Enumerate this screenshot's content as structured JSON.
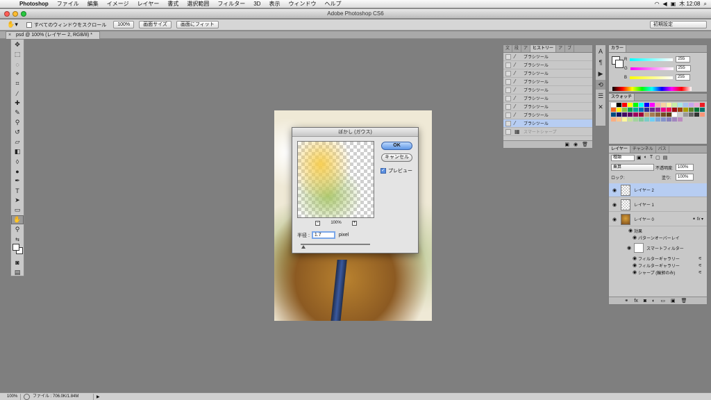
{
  "menubar": {
    "app": "Photoshop",
    "items": [
      "ファイル",
      "編集",
      "イメージ",
      "レイヤー",
      "書式",
      "選択範囲",
      "フィルター",
      "3D",
      "表示",
      "ウィンドウ",
      "ヘルプ"
    ],
    "clock": "木 12:08"
  },
  "window": {
    "title": "Adobe Photoshop CS6",
    "colors": {
      "close": "#ff5f57",
      "min": "#febc2e",
      "max": "#28c840"
    }
  },
  "options_bar": {
    "scroll_all_label": "すべてのウィンドウをスクロール",
    "zoom_100_label": "100%",
    "fit_screen_label": "画面サイズ",
    "fill_screen_label": "画面にフィット",
    "workspace": "初期設定"
  },
  "document_tab": {
    "title": "psd @ 100% (レイヤー 2, RGB/8) *"
  },
  "dialog": {
    "title": "ぼかし (ガウス)",
    "ok": "OK",
    "cancel": "キャンセル",
    "preview_label": "プレビュー",
    "zoom": "100%",
    "radius_label": "半径 :",
    "radius_value": "1.7",
    "unit": "pixel",
    "slider_fraction": 0.04
  },
  "history": {
    "tabs": [
      "文",
      "段",
      "ア",
      "ヒストリー",
      "ア",
      "ブ"
    ],
    "active_tab_index": 3,
    "items": [
      {
        "label": "ブラシツール",
        "state": "normal"
      },
      {
        "label": "ブラシツール",
        "state": "normal"
      },
      {
        "label": "ブラシツール",
        "state": "normal"
      },
      {
        "label": "ブラシツール",
        "state": "normal"
      },
      {
        "label": "ブラシツール",
        "state": "normal"
      },
      {
        "label": "ブラシツール",
        "state": "normal"
      },
      {
        "label": "ブラシツール",
        "state": "normal"
      },
      {
        "label": "ブラシツール",
        "state": "normal"
      },
      {
        "label": "ブラシツール",
        "state": "selected"
      },
      {
        "label": "スマートシャープ",
        "state": "dim"
      }
    ]
  },
  "color_panel": {
    "tab": "カラー",
    "r_label": "R",
    "r_value": "255",
    "g_label": "G",
    "g_value": "255",
    "b_label": "B",
    "b_value": "255"
  },
  "swatches_panel": {
    "tab": "スウォッチ",
    "colors": [
      "#ffffff",
      "#000000",
      "#ff0000",
      "#ffff00",
      "#00ff00",
      "#00ffff",
      "#0000ff",
      "#ff00ff",
      "#f5b0b0",
      "#f7d3a0",
      "#f9f4a0",
      "#c9eea6",
      "#a6e6e6",
      "#a6c1ee",
      "#c7a6ee",
      "#eea6d6",
      "#ed1c24",
      "#f26522",
      "#fff200",
      "#8dc63f",
      "#00a651",
      "#00a99d",
      "#0072bc",
      "#2e3192",
      "#662d91",
      "#92278f",
      "#ec008c",
      "#ed145b",
      "#9e0b0f",
      "#a0410d",
      "#aba000",
      "#598527",
      "#007236",
      "#00746b",
      "#004a80",
      "#1b1464",
      "#440e62",
      "#630460",
      "#9e005d",
      "#9e0039",
      "#c69c6d",
      "#a67c52",
      "#8c6239",
      "#754c24",
      "#603913",
      "#ffffff",
      "#cccccc",
      "#999999",
      "#666666",
      "#333333",
      "#f7977a",
      "#fbad82",
      "#fdc68c",
      "#fff799",
      "#c4df9b",
      "#a3d39c",
      "#82ca9c",
      "#7accc8",
      "#6dcff6",
      "#7da7d9",
      "#8393ca",
      "#8781bd",
      "#a186be",
      "#bd8cbf"
    ]
  },
  "layers_panel": {
    "tabs": [
      "レイヤー",
      "チャンネル",
      "パス"
    ],
    "active_tab_index": 0,
    "kind_filter": "種類",
    "blend_mode": "乗算",
    "opacity_label": "不透明度:",
    "opacity_value": "100%",
    "lock_label": "ロック:",
    "fill_label": "塗り:",
    "fill_value": "100%",
    "layers": [
      {
        "name": "レイヤー 2",
        "selected": true
      },
      {
        "name": "レイヤー 1",
        "selected": false
      },
      {
        "name": "レイヤー 0",
        "selected": false
      }
    ],
    "effects_label": "効果",
    "pattern_overlay": "パターンオーバーレイ",
    "smart_filters": "スマートフィルター",
    "filters": [
      "フィルターギャラリー",
      "フィルターギャラリー",
      "シャープ (輪郭のみ)"
    ]
  },
  "status_bar": {
    "zoom": "100%",
    "file_info": "ファイル : 706.0K/1.84M"
  }
}
